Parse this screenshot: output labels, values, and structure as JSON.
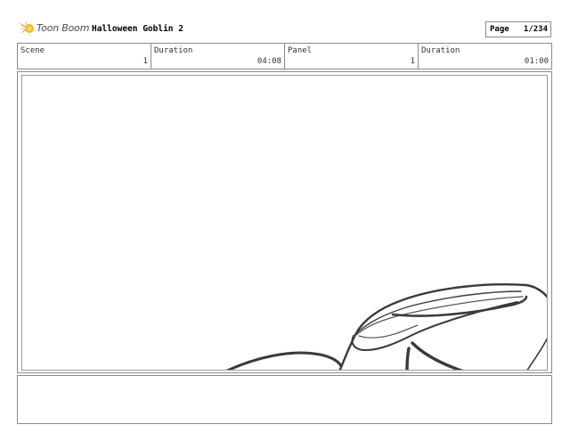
{
  "header": {
    "brand": "Toon Boom",
    "brand_icon": "toon-boom-starburst-icon",
    "project_title": "Halloween Goblin 2",
    "page_label": "Page",
    "page_value": "1/234"
  },
  "info_bar": {
    "scene_label": "Scene",
    "scene_value": "1",
    "scene_duration_label": "Duration",
    "scene_duration_value": "04:08",
    "panel_label": "Panel",
    "panel_value": "1",
    "panel_duration_label": "Duration",
    "panel_duration_value": "01:00"
  },
  "notes": {
    "text": ""
  },
  "colors": {
    "border": "#8a8a8a",
    "brand_orange": "#f2a81d",
    "sketch_stroke": "#3a3a3a"
  }
}
